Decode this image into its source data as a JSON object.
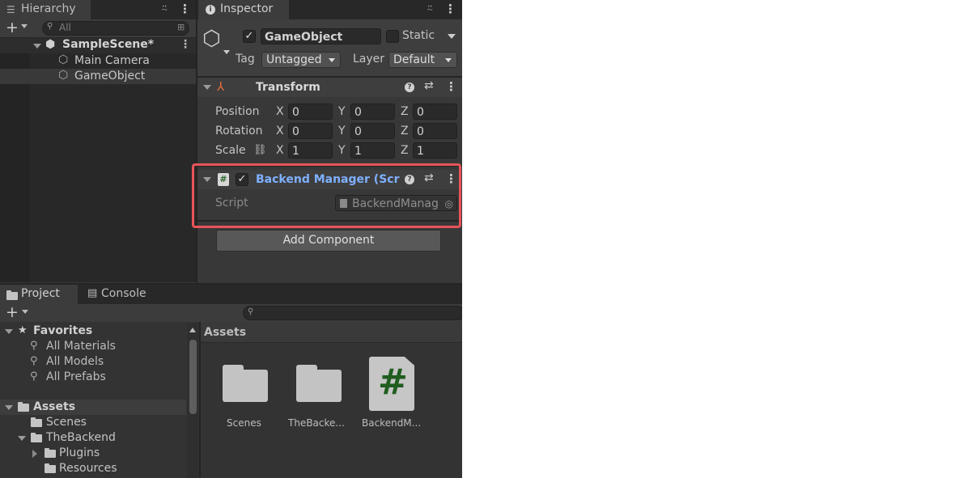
{
  "hierarchy": {
    "tab_label": "Hierarchy",
    "search_placeholder": "All",
    "add_label": "+",
    "items": [
      {
        "label": "SampleScene*"
      },
      {
        "label": "Main Camera"
      },
      {
        "label": "GameObject"
      }
    ]
  },
  "inspector": {
    "tab_label": "Inspector",
    "object_name": "GameObject",
    "static_label": "Static",
    "tag_label": "Tag",
    "tag_value": "Untagged",
    "layer_label": "Layer",
    "layer_value": "Default",
    "transform": {
      "title": "Transform",
      "rows": [
        {
          "label": "Position",
          "x": "0",
          "y": "0",
          "z": "0"
        },
        {
          "label": "Rotation",
          "x": "0",
          "y": "0",
          "z": "0"
        },
        {
          "label": "Scale",
          "x": "1",
          "y": "1",
          "z": "1"
        }
      ],
      "axis_x": "X",
      "axis_y": "Y",
      "axis_z": "Z"
    },
    "backend_manager": {
      "title": "Backend Manager (Scrip",
      "script_label": "Script",
      "script_value": "BackendManag"
    },
    "add_component_label": "Add Component",
    "highlight_color": "#e8545a"
  },
  "project": {
    "tab_project": "Project",
    "tab_console": "Console",
    "favorites": {
      "label": "Favorites",
      "items": [
        "All Materials",
        "All Models",
        "All Prefabs"
      ]
    },
    "assets_tree": {
      "label": "Assets",
      "children": [
        "Scenes",
        "TheBackend",
        "Plugins",
        "Resources"
      ]
    },
    "breadcrumb": "Assets",
    "grid_items": [
      {
        "label": "Scenes",
        "icon": "folder-icon"
      },
      {
        "label": "TheBacke...",
        "icon": "folder-icon"
      },
      {
        "label": "BackendM...",
        "icon": "csharp-script-icon"
      }
    ]
  }
}
